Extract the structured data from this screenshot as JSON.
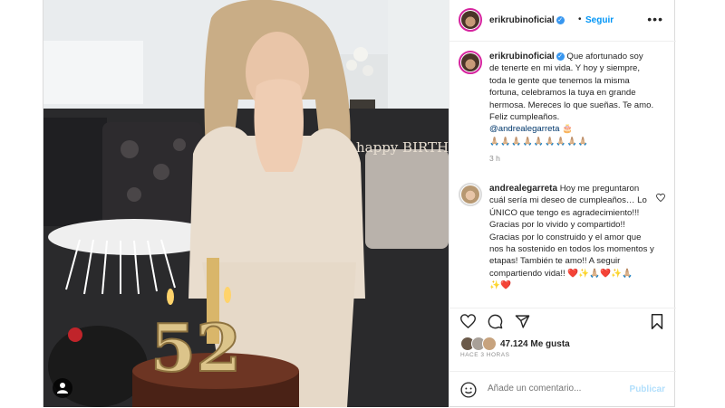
{
  "post_author": {
    "username": "erikrubinoficial",
    "follow_label": "Seguir",
    "separator": "•",
    "more_icon": "more-horizontal-icon"
  },
  "caption": {
    "username": "erikrubinoficial",
    "text": "Que afortunado soy de tenerte en mi vida. Y hoy y siempre, toda le gente que tenemos la misma fortuna, celebramos la tuya en grande hermosa. Mereces lo que sueñas. Te amo. Feliz cumpleaños.",
    "mention": "@andrealegarreta",
    "mention_emoji": "🎂",
    "emoji_line": "🙏🏼🙏🏼🙏🏼🙏🏼🙏🏼🙏🏼🙏🏼🙏🏼🙏🏼",
    "time": "3 h"
  },
  "reply": {
    "username": "andrealegarreta",
    "text": "Hoy me preguntaron cuál sería mi deseo de cumpleaños… Lo ÚNICO que tengo es agradecimiento!!! Gracias por lo vivido y compartido!! Gracias por lo construido y el amor que nos ha sostenido en todos los momentos y etapas! También te amo!! A seguir compartiendo vida!!",
    "emoji_tail": "❤️✨🙏🏼❤️✨🙏🏼",
    "emoji_tail2": "✨❤️"
  },
  "likes": {
    "count_text": "47.124 Me gusta",
    "ago": "HACE 3 HORAS"
  },
  "comment_box": {
    "placeholder": "Añade un comentario...",
    "publish_label": "Publicar"
  },
  "photo_text": {
    "banner": "happy BIRTHDAY",
    "candle_digits": "52"
  },
  "colors": {
    "link": "#0095f6",
    "verified": "#3897f0",
    "heart": "#ed4956"
  }
}
